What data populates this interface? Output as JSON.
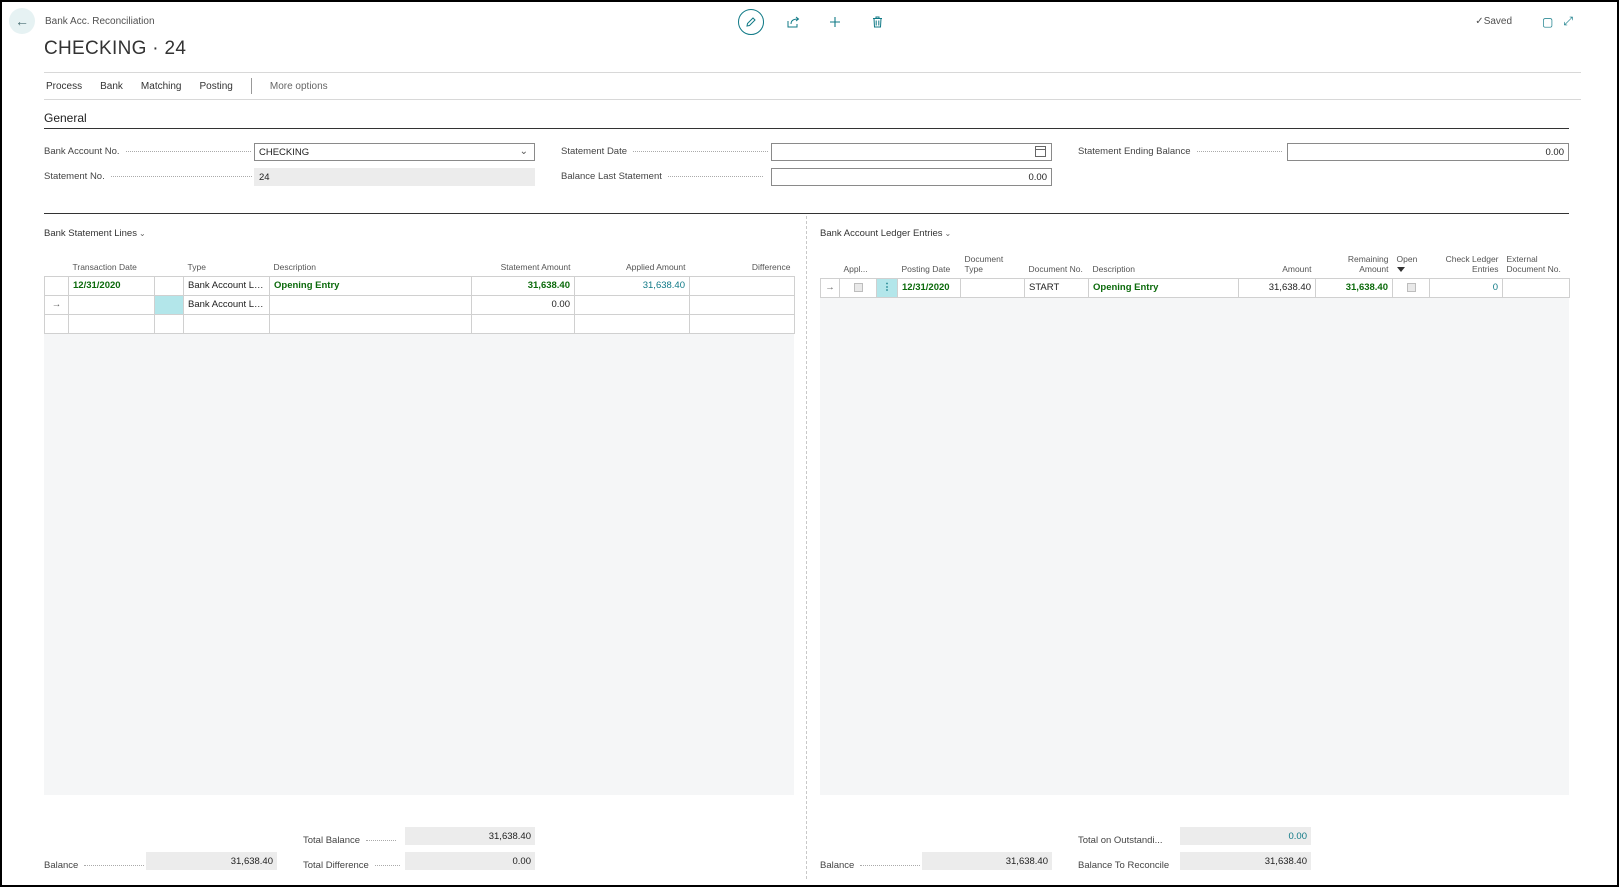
{
  "header": {
    "caption": "Bank Acc. Reconciliation",
    "title": "CHECKING · 24",
    "saved": "Saved",
    "icons": [
      "back-arrow-icon",
      "edit-icon",
      "share-icon",
      "plus-icon",
      "delete-icon",
      "open-in-new-window-icon",
      "collapse-icon"
    ]
  },
  "actions": {
    "process": "Process",
    "bank": "Bank",
    "matching": "Matching",
    "posting": "Posting",
    "more": "More options"
  },
  "general": {
    "title": "General",
    "bank_account_no_label": "Bank Account No.",
    "bank_account_no_value": "CHECKING",
    "statement_no_label": "Statement No.",
    "statement_no_value": "24",
    "statement_date_label": "Statement Date",
    "statement_date_value": "",
    "balance_last_statement_label": "Balance Last Statement",
    "balance_last_statement_value": "0.00",
    "statement_ending_balance_label": "Statement Ending Balance",
    "statement_ending_balance_value": "0.00"
  },
  "statement_lines": {
    "title": "Bank Statement Lines",
    "columns": [
      "Transaction Date",
      "Type",
      "Description",
      "Statement Amount",
      "Applied Amount",
      "Difference"
    ],
    "rows": [
      {
        "date": "12/31/2020",
        "type": "Bank Account Le...",
        "description": "Opening Entry",
        "statement_amount": "31,638.40",
        "applied_amount": "31,638.40",
        "difference": ""
      },
      {
        "date": "",
        "type": "Bank Account Le...",
        "description": "",
        "statement_amount": "0.00",
        "applied_amount": "",
        "difference": ""
      }
    ],
    "totals": {
      "total_balance_label": "Total Balance",
      "total_balance_value": "31,638.40",
      "total_difference_label": "Total Difference",
      "total_difference_value": "0.00",
      "balance_label": "Balance",
      "balance_value": "31,638.40"
    }
  },
  "ledger_entries": {
    "title": "Bank Account Ledger Entries",
    "columns": {
      "applied": "Appl...",
      "posting_date": "Posting Date",
      "document_type": "Document Type",
      "document_no": "Document No.",
      "description": "Description",
      "amount": "Amount",
      "remaining_amount": "Remaining Amount",
      "open": "Open",
      "check_ledger_entries": "Check Ledger Entries",
      "external_document_no": "External Document No."
    },
    "rows": [
      {
        "posting_date": "12/31/2020",
        "document_type": "",
        "document_no": "START",
        "description": "Opening Entry",
        "amount": "31,638.40",
        "remaining_amount": "31,638.40",
        "check_ledger_entries": "0",
        "external_document_no": ""
      }
    ],
    "totals": {
      "total_outstanding_label": "Total on Outstandi...",
      "total_outstanding_value": "0.00",
      "balance_to_reconcile_label": "Balance To Reconcile",
      "balance_to_reconcile_value": "31,638.40",
      "balance_label": "Balance",
      "balance_value": "31,638.40"
    }
  }
}
